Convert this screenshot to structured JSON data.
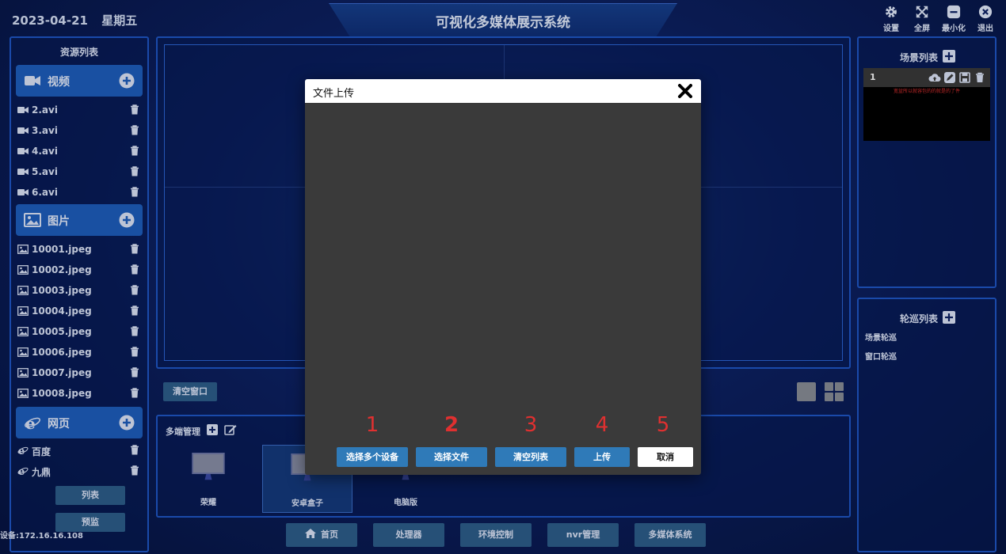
{
  "header": {
    "date": "2023-04-21",
    "weekday": "星期五",
    "title": "可视化多媒体展示系统",
    "buttons": {
      "settings": "设置",
      "fullscreen": "全屏",
      "minimize": "最小化",
      "exit": "退出"
    }
  },
  "sidebar": {
    "title": "资源列表",
    "video": {
      "label": "视频",
      "items": [
        "2.avi",
        "3.avi",
        "4.avi",
        "5.avi",
        "6.avi"
      ]
    },
    "image": {
      "label": "图片",
      "items": [
        "10001.jpeg",
        "10002.jpeg",
        "10003.jpeg",
        "10004.jpeg",
        "10005.jpeg",
        "10006.jpeg",
        "10007.jpeg",
        "10008.jpeg"
      ]
    },
    "web": {
      "label": "网页",
      "items": [
        "百度",
        "九鼎"
      ]
    },
    "list_button": "列表",
    "preview_button": "预监",
    "device_ip": "设备:172.16.16.108"
  },
  "main": {
    "clear_window": "清空窗口"
  },
  "multi": {
    "title": "多端管理",
    "devices": [
      "荣耀",
      "安卓盒子",
      "电脑版"
    ]
  },
  "nav": [
    "首页",
    "处理器",
    "环境控制",
    "nvr管理",
    "多媒体系统"
  ],
  "scene_list": {
    "title": "场景列表",
    "card_number": "1",
    "card_caption": "宽盆所以就容包的的就是的了件"
  },
  "tour_list": {
    "title": "轮巡列表",
    "items": [
      "场景轮巡",
      "窗口轮巡"
    ]
  },
  "modal": {
    "title": "文件上传",
    "step_numbers": [
      "1",
      "2",
      "3",
      "4",
      "5"
    ],
    "buttons": [
      "选择多个设备",
      "选择文件",
      "清空列表",
      "上传",
      "取消"
    ]
  },
  "colors": {
    "accent": "#1e5fbf",
    "button": "#2d5f8c",
    "modal_button": "#2f7ab8",
    "step_number": "#e03030"
  }
}
